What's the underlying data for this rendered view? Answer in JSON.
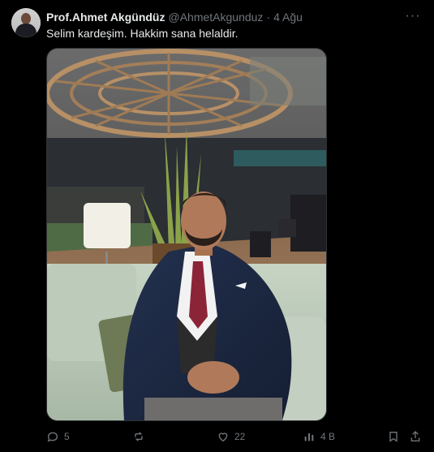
{
  "tweet": {
    "display_name": "Prof.Ahmet Akgündüz",
    "handle": "@AhmetAkgunduz",
    "separator": "·",
    "date": "4 Ağu",
    "text": "Selim kardeşim. Hakkim sana helaldir.",
    "more_icon": "more-icon"
  },
  "actions": {
    "replies": "5",
    "retweets": "",
    "likes": "22",
    "views": "4 B"
  },
  "colors": {
    "background": "#000000",
    "text": "#e7e9ea",
    "muted": "#71767b",
    "border": "#2f3336"
  }
}
